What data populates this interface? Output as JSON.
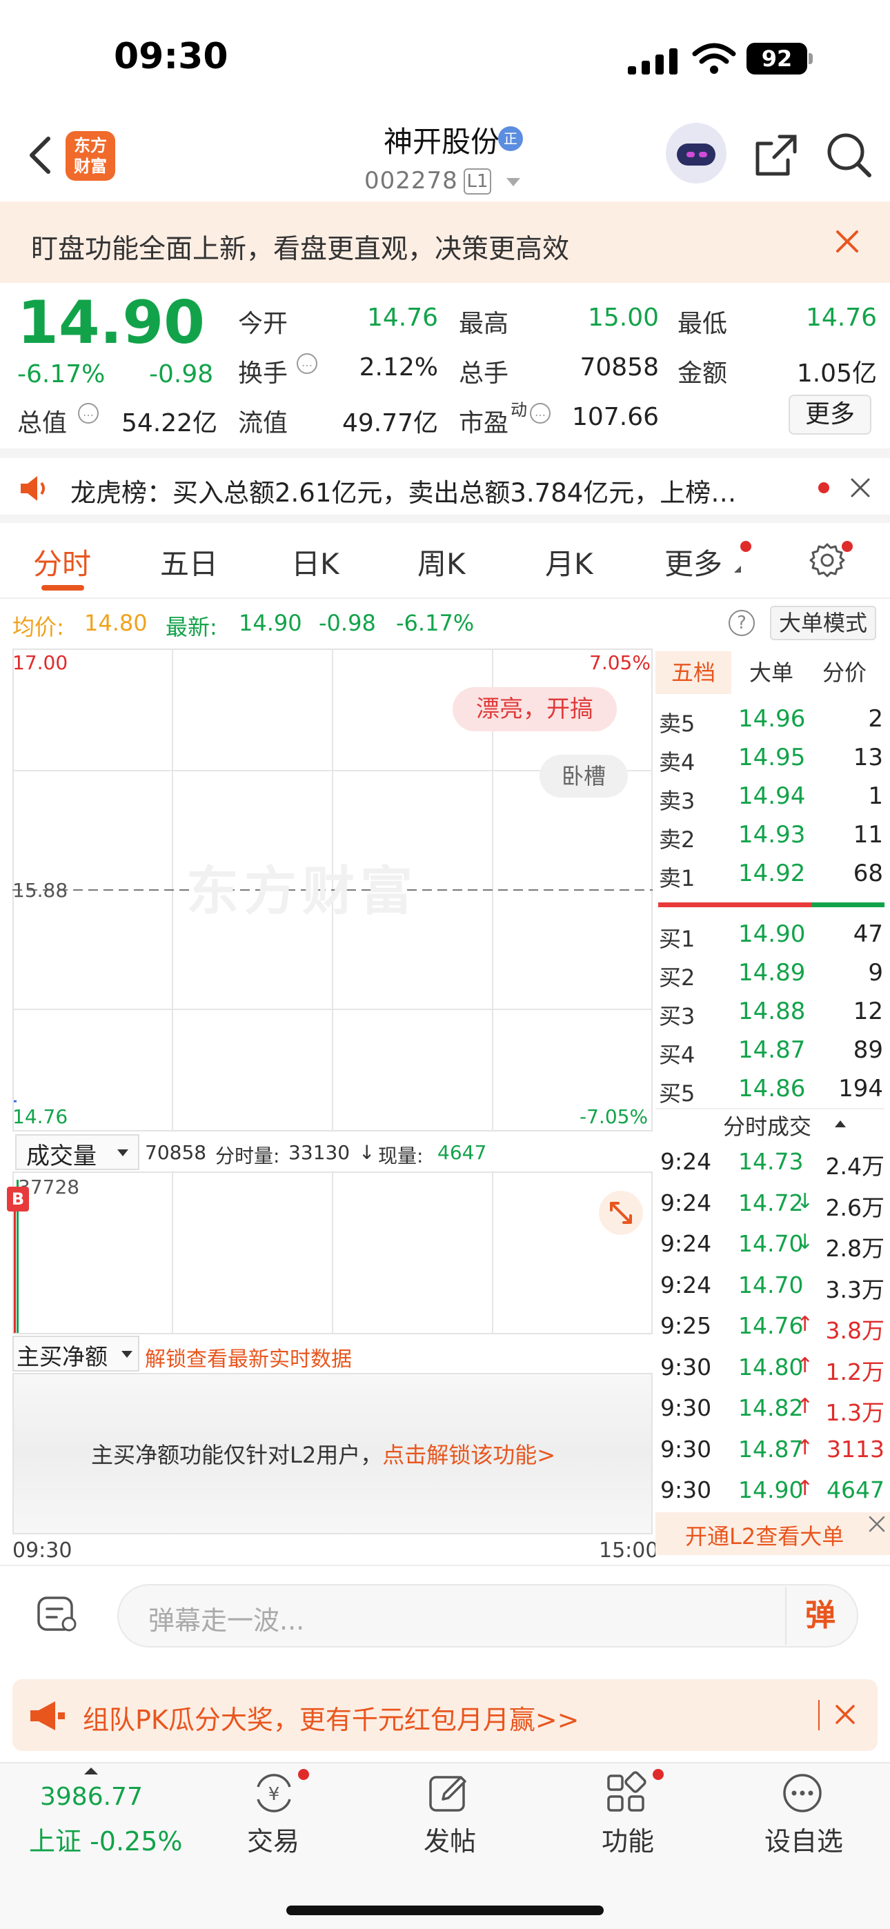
{
  "status": {
    "time": "09:30",
    "battery": "92"
  },
  "header": {
    "logo_line1": "东方",
    "logo_line2": "财富",
    "name": "神开股份",
    "name_badge": "正",
    "code": "002278",
    "level": "L1"
  },
  "banner": {
    "text": "盯盘功能全面上新，看盘更直观，决策更高效"
  },
  "quote": {
    "price": "14.90",
    "change_pct": "-6.17%",
    "change_abs": "-0.98",
    "open_label": "今开",
    "open": "14.76",
    "high_label": "最高",
    "high": "15.00",
    "low_label": "最低",
    "low": "14.76",
    "turnover_label": "换手",
    "turnover": "2.12%",
    "volume_label": "总手",
    "volume": "70858",
    "amount_label": "金额",
    "amount": "1.05亿",
    "mktcap_label": "总值",
    "mktcap": "54.22亿",
    "float_label": "流值",
    "float": "49.77亿",
    "pe_label": "市盈",
    "pe_sup": "动",
    "pe": "107.66",
    "more": "更多"
  },
  "lhb": {
    "text": "龙虎榜：买入总额2.61亿元，卖出总额3.784亿元，上榜…"
  },
  "tabs": [
    "分时",
    "五日",
    "日K",
    "周K",
    "月K",
    "更多"
  ],
  "avg_row": {
    "avg_label": "均价:",
    "avg": "14.80",
    "last_label": "最新:",
    "last": "14.90",
    "last_chg": "-0.98",
    "last_pct": "-6.17%",
    "help": "?",
    "big_mode": "大单模式"
  },
  "chart": {
    "y_top": "17.00",
    "y_mid": "15.88",
    "y_bot": "14.76",
    "pct_top": "7.05%",
    "pct_bot": "-7.05%",
    "watermark": "东方财富",
    "bubble1": "漂亮，开搞",
    "bubble2": "卧槽",
    "time_start": "09:30",
    "time_end": "15:00"
  },
  "chart_data": {
    "type": "line",
    "title": "",
    "x": [
      "09:30"
    ],
    "series": [
      {
        "values": [
          14.9
        ]
      }
    ],
    "ylim": [
      14.76,
      17.0
    ],
    "reference": 15.88
  },
  "volume": {
    "selector": "成交量",
    "total": "70858",
    "period_label": "分时量:",
    "period": "33130",
    "now_label": "现量:",
    "now": "4647",
    "y_top": "37728",
    "badge": "B"
  },
  "net_buy": {
    "selector": "主买净额",
    "link": "解锁查看最新实时数据",
    "msg": "主买净额功能仅针对L2用户，",
    "msg_link": "点击解锁该功能>"
  },
  "orderbook": {
    "tabs": [
      "五档",
      "大单",
      "分价"
    ],
    "asks": [
      {
        "label": "卖5",
        "price": "14.96",
        "vol": "2"
      },
      {
        "label": "卖4",
        "price": "14.95",
        "vol": "13"
      },
      {
        "label": "卖3",
        "price": "14.94",
        "vol": "1"
      },
      {
        "label": "卖2",
        "price": "14.93",
        "vol": "11"
      },
      {
        "label": "卖1",
        "price": "14.92",
        "vol": "68"
      }
    ],
    "bids": [
      {
        "label": "买1",
        "price": "14.90",
        "vol": "47"
      },
      {
        "label": "买2",
        "price": "14.89",
        "vol": "9"
      },
      {
        "label": "买3",
        "price": "14.88",
        "vol": "12"
      },
      {
        "label": "买4",
        "price": "14.87",
        "vol": "89"
      },
      {
        "label": "买5",
        "price": "14.86",
        "vol": "194"
      }
    ],
    "ticks_head": "分时成交",
    "ticks": [
      {
        "time": "9:24",
        "price": "14.73",
        "arrow": "",
        "vol": "2.4万",
        "dir": "n"
      },
      {
        "time": "9:24",
        "price": "14.72",
        "arrow": "↓",
        "vol": "2.6万",
        "dir": "n"
      },
      {
        "time": "9:24",
        "price": "14.70",
        "arrow": "↓",
        "vol": "2.8万",
        "dir": "n"
      },
      {
        "time": "9:24",
        "price": "14.70",
        "arrow": "",
        "vol": "3.3万",
        "dir": "n"
      },
      {
        "time": "9:25",
        "price": "14.76",
        "arrow": "↑",
        "vol": "3.8万",
        "dir": "r"
      },
      {
        "time": "9:30",
        "price": "14.80",
        "arrow": "↑",
        "vol": "1.2万",
        "dir": "r"
      },
      {
        "time": "9:30",
        "price": "14.82",
        "arrow": "↑",
        "vol": "1.3万",
        "dir": "r"
      },
      {
        "time": "9:30",
        "price": "14.87",
        "arrow": "↑",
        "vol": "3113",
        "dir": "r"
      },
      {
        "time": "9:30",
        "price": "14.90",
        "arrow": "↑",
        "vol": "4647",
        "dir": "g"
      }
    ],
    "l2_text": "开通L2查看大单"
  },
  "comment": {
    "placeholder": "弹幕走一波...",
    "dan": "弹"
  },
  "promo": {
    "text": "组队PK瓜分大奖，更有千元红包月月赢>>"
  },
  "nav": {
    "index_value": "3986.77",
    "index_label": "上证 -0.25%",
    "items": [
      "交易",
      "发帖",
      "功能",
      "设自选"
    ]
  }
}
